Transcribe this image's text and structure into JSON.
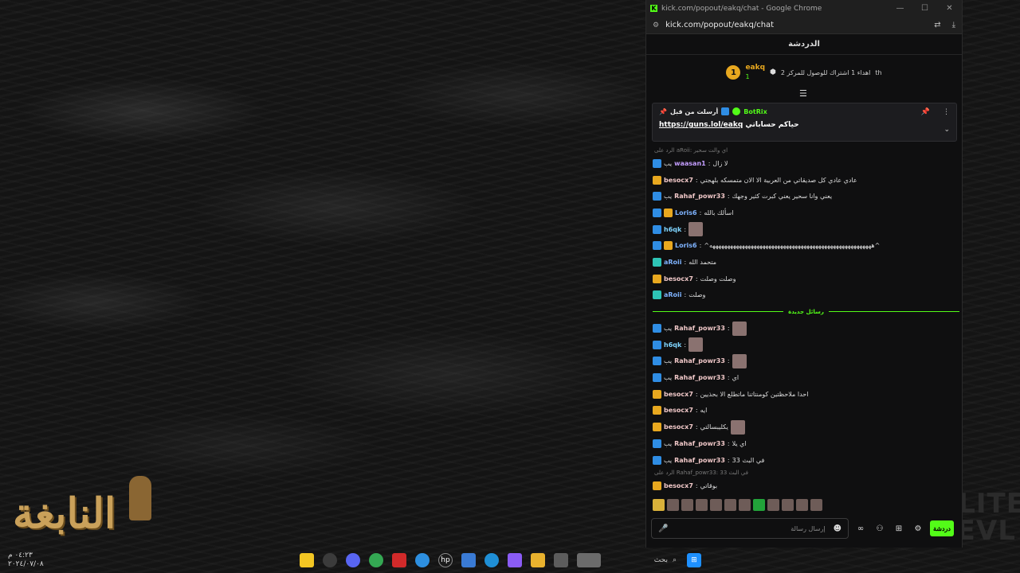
{
  "window": {
    "title": "kick.com/popout/eakq/chat - Google Chrome",
    "url": "kick.com/popout/eakq/chat",
    "controls": [
      "—",
      "☐",
      "✕"
    ]
  },
  "chat": {
    "header": "الدردشة",
    "goal": {
      "rank": "1",
      "user": "eakq",
      "count": "1",
      "text": "اهداء 1 اشتراك للوصول للمركز 2",
      "suffix": "th"
    },
    "pinned": {
      "sender_label": "أرسلت من قبل",
      "user": "BotRix",
      "message": "حياكم حساباتي",
      "link": "https://guns.lol/eakq"
    },
    "new_messages_label": "رسائل جديدة",
    "input_placeholder": "إرسال رسالة",
    "send_label": "دردشة"
  },
  "messages_before": [
    {
      "type": "reply",
      "text": "الرد على aRoii: اي والت سحير"
    },
    {
      "user": "waasan1",
      "color": "#c39dfd",
      "badges": [
        "blue"
      ],
      "text": "لا زال",
      "prefix": "يب"
    },
    {
      "user": "besocx7",
      "color": "#f0c8c8",
      "badges": [
        "gold"
      ],
      "text": "عادي عادي كل صديقاتي من العربية الا الان متمسكه بلهجتي"
    },
    {
      "user": "Rahaf_powr33",
      "color": "#f0c8c8",
      "badges": [
        "blue"
      ],
      "text": "يعني وانا سحير يعني كبرت كثير وجهك",
      "prefix": "يب"
    },
    {
      "user": "Loris6",
      "color": "#7fb3ff",
      "badges": [
        "blue",
        "gold"
      ],
      "text": "اسألك بالله"
    },
    {
      "user": "h6qk",
      "color": "#7fd4ff",
      "badges": [
        "blue"
      ],
      "text": "",
      "emote": true
    },
    {
      "user": "Loris6",
      "color": "#7fb3ff",
      "badges": [
        "blue",
        "gold"
      ],
      "text": "^هههههههههههههههههههههههههههههههههههههههههههههههههههههههه^"
    },
    {
      "user": "aRoii",
      "color": "#7fb3ff",
      "badges": [
        "teal"
      ],
      "text": "متحمد الله"
    },
    {
      "user": "besocx7",
      "color": "#f0c8c8",
      "badges": [
        "gold"
      ],
      "text": "وصلت وصلت"
    },
    {
      "user": "aRoii",
      "color": "#7fb3ff",
      "badges": [
        "teal"
      ],
      "text": "وصلت"
    }
  ],
  "messages_after": [
    {
      "user": "Rahaf_powr33",
      "color": "#f0c8c8",
      "badges": [
        "blue"
      ],
      "text": "",
      "prefix": "يب",
      "emote": true
    },
    {
      "user": "h6qk",
      "color": "#7fd4ff",
      "badges": [
        "blue"
      ],
      "text": "",
      "emote": true
    },
    {
      "user": "Rahaf_powr33",
      "color": "#f0c8c8",
      "badges": [
        "blue"
      ],
      "text": "",
      "prefix": "يب",
      "emote": true
    },
    {
      "user": "Rahaf_powr33",
      "color": "#f0c8c8",
      "badges": [
        "blue"
      ],
      "text": "اي",
      "prefix": "يب"
    },
    {
      "user": "besocx7",
      "color": "#f0c8c8",
      "badges": [
        "gold"
      ],
      "text": "احدا ملاحظتين كومنتاتنا ماتطلع الا بحذيين"
    },
    {
      "user": "besocx7",
      "color": "#f0c8c8",
      "badges": [
        "gold"
      ],
      "text": "ايه"
    },
    {
      "user": "besocx7",
      "color": "#f0c8c8",
      "badges": [
        "gold"
      ],
      "text": "يكليبسالتي",
      "emote": true
    },
    {
      "user": "Rahaf_powr33",
      "color": "#f0c8c8",
      "badges": [
        "blue"
      ],
      "text": "اي يلا",
      "prefix": "يب"
    },
    {
      "user": "Rahaf_powr33",
      "color": "#f0c8c8",
      "badges": [
        "blue"
      ],
      "text": "في البث 33",
      "prefix": "يب"
    },
    {
      "type": "reply",
      "text": "الرد على Rahaf_powr33: 33 في البث"
    },
    {
      "user": "besocx7",
      "color": "#f0c8c8",
      "badges": [
        "gold"
      ],
      "text": "بوقاتي"
    }
  ],
  "taskbar": {
    "search_label": "بحث",
    "clock_time": "٠٤:٢٣ م",
    "clock_date": "٢٠٢٤/٠٧/٠٨"
  },
  "logo": {
    "text": "النابغة"
  },
  "deco_logo": {
    "text": "ELITE LEVL"
  }
}
